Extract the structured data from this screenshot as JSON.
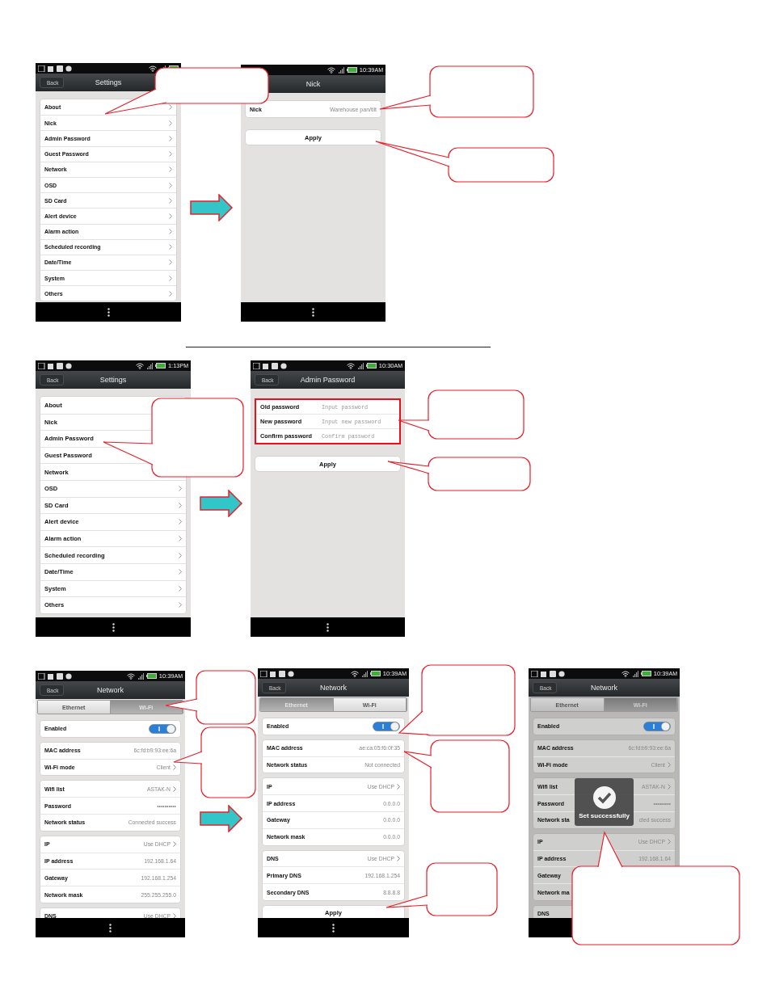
{
  "rows": [
    {
      "screens": [
        {
          "kind": "settings",
          "status": {
            "notification_icons": true
          },
          "header": {
            "back": "Back",
            "title": "Settings"
          },
          "items": [
            {
              "label": "About",
              "chevron": true
            },
            {
              "label": "Nick",
              "chevron": true
            },
            {
              "label": "Admin Password",
              "chevron": true
            },
            {
              "label": "Guest Password",
              "chevron": true
            },
            {
              "label": "Network",
              "chevron": true
            },
            {
              "label": "OSD",
              "chevron": true
            },
            {
              "label": "SD Card",
              "chevron": true
            },
            {
              "label": "Alert device",
              "chevron": true
            },
            {
              "label": "Alarm action",
              "chevron": true
            },
            {
              "label": "Scheduled recording",
              "chevron": true
            },
            {
              "label": "Date/Time",
              "chevron": true
            },
            {
              "label": "System",
              "chevron": true
            },
            {
              "label": "Others",
              "chevron": true
            }
          ]
        },
        {
          "kind": "nick",
          "status": {
            "notification_icons": false,
            "time": "10:39",
            "ampm": "AM"
          },
          "header": {
            "title": "Nick"
          },
          "field": {
            "label": "Nick",
            "value": "Warehouse pan/tilt"
          },
          "button": "Apply"
        }
      ]
    },
    {
      "screens": [
        {
          "kind": "settings",
          "status": {
            "notification_icons": true,
            "time": "1:13",
            "ampm": "PM"
          },
          "header": {
            "back": "Back",
            "title": "Settings"
          },
          "items": [
            {
              "label": "About"
            },
            {
              "label": "Nick"
            },
            {
              "label": "Admin Password"
            },
            {
              "label": "Guest Password"
            },
            {
              "label": "Network"
            },
            {
              "label": "OSD",
              "chevron": true
            },
            {
              "label": "SD Card",
              "chevron": true
            },
            {
              "label": "Alert device",
              "chevron": true
            },
            {
              "label": "Alarm action",
              "chevron": true
            },
            {
              "label": "Scheduled recording",
              "chevron": true
            },
            {
              "label": "Date/Time",
              "chevron": true
            },
            {
              "label": "System",
              "chevron": true
            },
            {
              "label": "Others",
              "chevron": true
            }
          ]
        },
        {
          "kind": "password",
          "status": {
            "notification_icons": true,
            "time": "10:30",
            "ampm": "AM"
          },
          "header": {
            "back": "Back",
            "title": "Admin Password"
          },
          "highlighted": true,
          "fields": [
            {
              "label": "Old password",
              "placeholder": "Input password"
            },
            {
              "label": "New password",
              "placeholder": "Input new password"
            },
            {
              "label": "Confirm password",
              "placeholder": "Confirm password"
            }
          ],
          "button": "Apply"
        }
      ]
    },
    {
      "screens": [
        {
          "kind": "network",
          "status": {
            "notification_icons": true,
            "time": "10:39",
            "ampm": "AM"
          },
          "header": {
            "back": "Back",
            "title": "Network"
          },
          "dimmed": false,
          "tabs": [
            {
              "label": "Ethernet",
              "selected": false
            },
            {
              "label": "Wi-Fi",
              "selected": true
            }
          ],
          "enabled": {
            "label": "Enabled",
            "on": true
          },
          "groups": [
            [
              {
                "label": "MAC address",
                "value": "6c:fd:b9:93:ee:6a",
                "chevron": false
              },
              {
                "label": "Wi-Fi mode",
                "value": "Client",
                "chevron": true
              }
            ],
            [
              {
                "label": "Wifi list",
                "value": "ASTAK-N",
                "chevron": true
              },
              {
                "label": "Password",
                "value": "••••••••••",
                "chevron": false
              },
              {
                "label": "Network status",
                "value": "Connected success",
                "chevron": false
              }
            ],
            [
              {
                "label": "IP",
                "value": "Use DHCP",
                "chevron": true
              },
              {
                "label": "IP address",
                "value": "192.168.1.64",
                "chevron": false
              },
              {
                "label": "Gateway",
                "value": "192.168.1.254",
                "chevron": false
              },
              {
                "label": "Network mask",
                "value": "255.255.255.0",
                "chevron": false
              }
            ],
            [
              {
                "label": "DNS",
                "value": "Use DHCP",
                "chevron": true
              }
            ]
          ]
        },
        {
          "kind": "network",
          "status": {
            "notification_icons": true,
            "time": "10:39",
            "ampm": "AM"
          },
          "header": {
            "back": "Back",
            "title": "Network"
          },
          "dimmed": false,
          "tabs": [
            {
              "label": "Ethernet",
              "selected": true
            },
            {
              "label": "Wi-Fi",
              "selected": false
            }
          ],
          "enabled": {
            "label": "Enabled",
            "on": true
          },
          "groups": [
            [
              {
                "label": "MAC address",
                "value": "ae:ca:05:f6:0f:35",
                "chevron": false
              },
              {
                "label": "Network status",
                "value": "Not connected",
                "chevron": false
              }
            ],
            [
              {
                "label": "IP",
                "value": "Use DHCP",
                "chevron": true
              },
              {
                "label": "IP address",
                "value": "0.0.0.0",
                "chevron": false
              },
              {
                "label": "Gateway",
                "value": "0.0.0.0",
                "chevron": false
              },
              {
                "label": "Network mask",
                "value": "0.0.0.0",
                "chevron": false
              }
            ],
            [
              {
                "label": "DNS",
                "value": "Use DHCP",
                "chevron": true
              },
              {
                "label": "Primary DNS",
                "value": "192.168.1.254",
                "chevron": false
              },
              {
                "label": "Secondary DNS",
                "value": "8.8.8.8",
                "chevron": false
              }
            ]
          ],
          "button": "Apply"
        },
        {
          "kind": "network",
          "status": {
            "notification_icons": true,
            "time": "10:39",
            "ampm": "AM"
          },
          "header": {
            "back": "Back",
            "title": "Network"
          },
          "dimmed": true,
          "tabs": [
            {
              "label": "Ethernet",
              "selected": false
            },
            {
              "label": "Wi-Fi",
              "selected": true
            }
          ],
          "enabled": {
            "label": "Enabled",
            "on": true
          },
          "groups": [
            [
              {
                "label": "MAC address",
                "value": "6c:fd:b9:93:ee:6a",
                "chevron": false
              },
              {
                "label": "Wi-Fi mode",
                "value": "Client",
                "chevron": true
              }
            ],
            [
              {
                "label": "Wifi list",
                "value": "ASTAK-N",
                "chevron": true
              },
              {
                "label": "Password",
                "value": "•••••••••",
                "chevron": false
              },
              {
                "label": "Network sta",
                "value": "cted success",
                "chevron": false
              }
            ],
            [
              {
                "label": "IP",
                "value": "Use DHCP",
                "chevron": true
              },
              {
                "label": "IP address",
                "value": "192.168.1.64",
                "chevron": false
              },
              {
                "label": "Gateway"
              },
              {
                "label": "Network ma"
              }
            ],
            [
              {
                "label": "DNS"
              }
            ]
          ],
          "toast": {
            "text": "Set successfully"
          }
        }
      ]
    }
  ]
}
